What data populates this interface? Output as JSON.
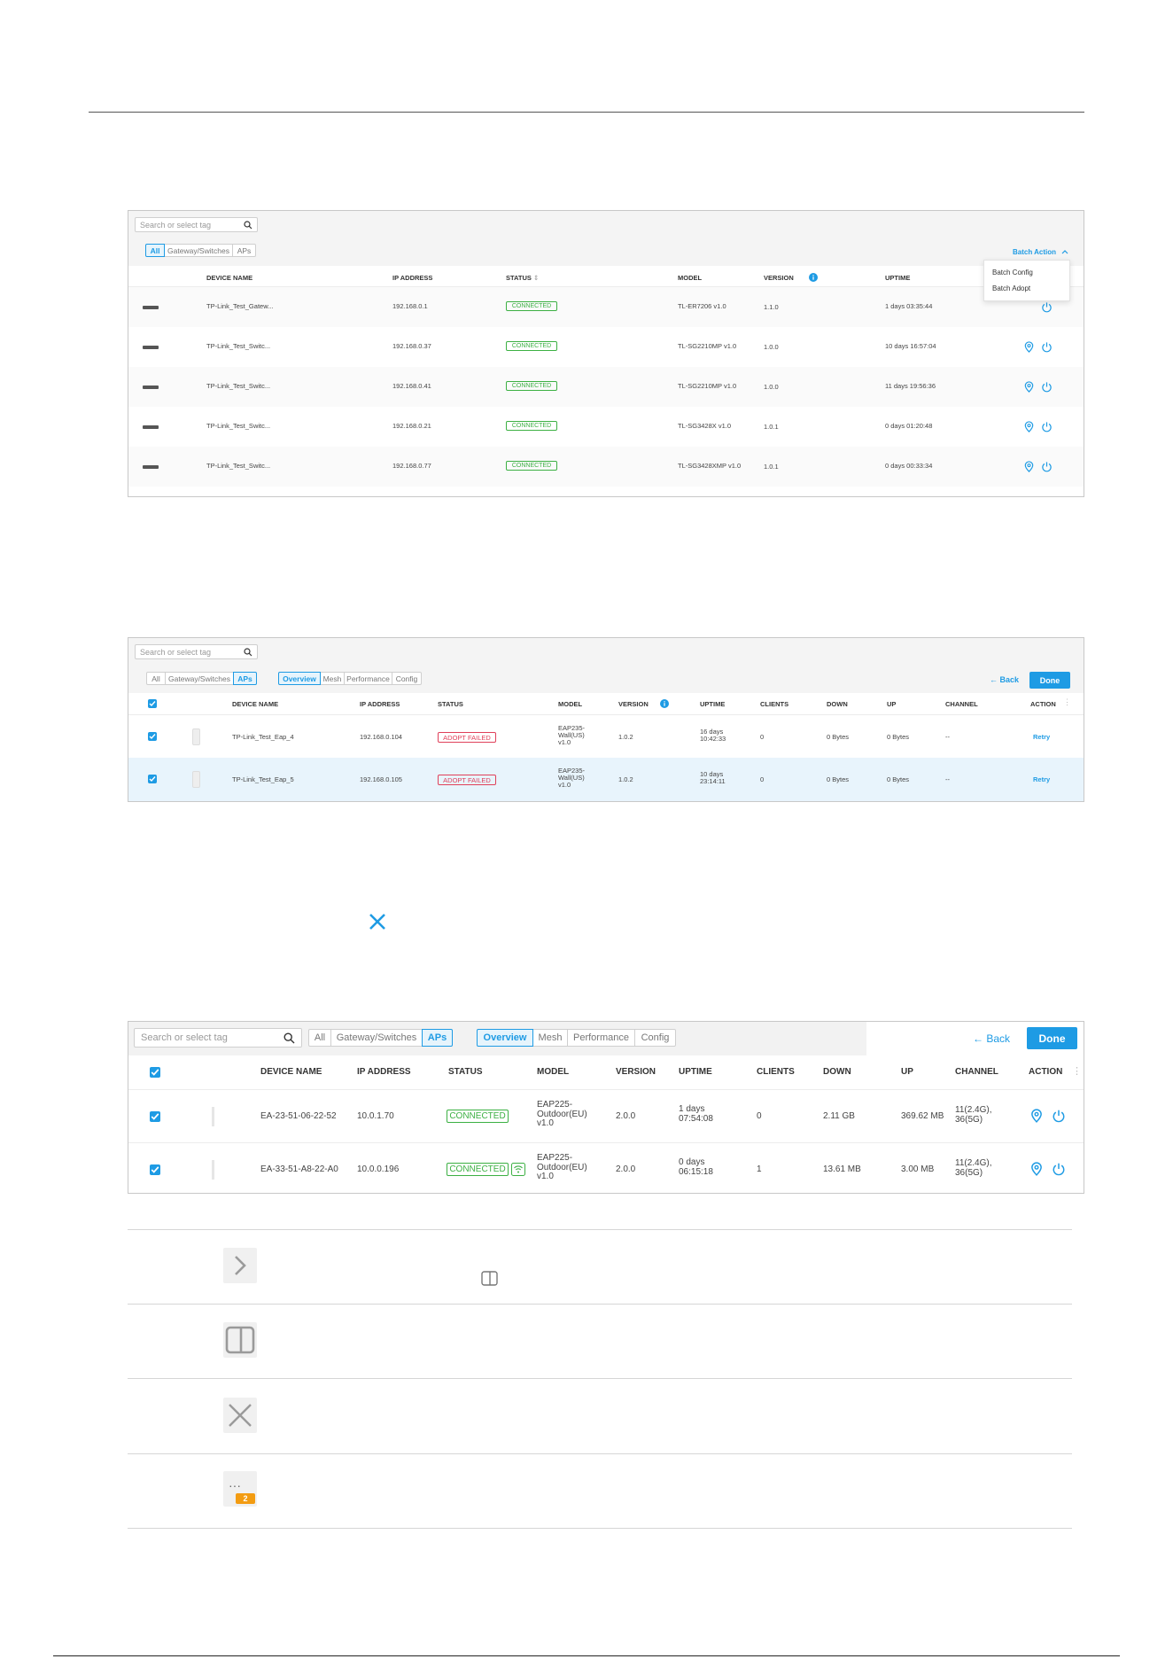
{
  "screenshot1": {
    "search_placeholder": "Search or select tag",
    "filters": [
      "All",
      "Gateway/Switches",
      "APs"
    ],
    "active_filter": "All",
    "batch_action_label": "Batch Action",
    "batch_menu": [
      "Batch Config",
      "Batch Adopt"
    ],
    "headers": {
      "device_name": "DEVICE NAME",
      "ip": "IP ADDRESS",
      "status": "STATUS",
      "model": "MODEL",
      "version": "VERSION",
      "uptime": "UPTIME"
    },
    "rows": [
      {
        "name": "TP-Link_Test_Gatew...",
        "ip": "192.168.0.1",
        "status": "CONNECTED",
        "model": "TL-ER7206 v1.0",
        "version": "1.1.0",
        "uptime": "1 days 03:35:44"
      },
      {
        "name": "TP-Link_Test_Switc...",
        "ip": "192.168.0.37",
        "status": "CONNECTED",
        "model": "TL-SG2210MP v1.0",
        "version": "1.0.0",
        "uptime": "10 days 16:57:04"
      },
      {
        "name": "TP-Link_Test_Switc...",
        "ip": "192.168.0.41",
        "status": "CONNECTED",
        "model": "TL-SG2210MP v1.0",
        "version": "1.0.0",
        "uptime": "11 days 19:56:36"
      },
      {
        "name": "TP-Link_Test_Switc...",
        "ip": "192.168.0.21",
        "status": "CONNECTED",
        "model": "TL-SG3428X v1.0",
        "version": "1.0.1",
        "uptime": "0 days 01:20:48"
      },
      {
        "name": "TP-Link_Test_Switc...",
        "ip": "192.168.0.77",
        "status": "CONNECTED",
        "model": "TL-SG3428XMP v1.0",
        "version": "1.0.1",
        "uptime": "0 days 00:33:34"
      }
    ]
  },
  "screenshot2": {
    "search_placeholder": "Search or select tag",
    "filters": [
      "All",
      "Gateway/Switches",
      "APs"
    ],
    "views": [
      "Overview",
      "Mesh",
      "Performance",
      "Config"
    ],
    "back_label": "Back",
    "done_label": "Done",
    "headers": {
      "device_name": "DEVICE NAME",
      "ip": "IP ADDRESS",
      "status": "STATUS",
      "model": "MODEL",
      "version": "VERSION",
      "uptime": "UPTIME",
      "clients": "CLIENTS",
      "down": "DOWN",
      "up": "UP",
      "channel": "CHANNEL",
      "action": "ACTION"
    },
    "rows": [
      {
        "name": "TP-Link_Test_Eap_4",
        "ip": "192.168.0.104",
        "status": "ADOPT FAILED",
        "model": [
          "EAP235-",
          "Wall(US)",
          "v1.0"
        ],
        "version": "1.0.2",
        "uptime": [
          "16 days",
          "10:42:33"
        ],
        "clients": "0",
        "down": "0 Bytes",
        "up": "0 Bytes",
        "channel": "--",
        "action": "Retry"
      },
      {
        "name": "TP-Link_Test_Eap_5",
        "ip": "192.168.0.105",
        "status": "ADOPT FAILED",
        "model": [
          "EAP235-",
          "Wall(US)",
          "v1.0"
        ],
        "version": "1.0.2",
        "uptime": [
          "10 days",
          "23:14:11"
        ],
        "clients": "0",
        "down": "0 Bytes",
        "up": "0 Bytes",
        "channel": "--",
        "action": "Retry"
      }
    ]
  },
  "screenshot3": {
    "search_placeholder": "Search or select tag",
    "filters": [
      "All",
      "Gateway/Switches",
      "APs"
    ],
    "views": [
      "Overview",
      "Mesh",
      "Performance",
      "Config"
    ],
    "back_label": "Back",
    "done_label": "Done",
    "headers": {
      "device_name": "DEVICE NAME",
      "ip": "IP ADDRESS",
      "status": "STATUS",
      "model": "MODEL",
      "version": "VERSION",
      "uptime": "UPTIME",
      "clients": "CLIENTS",
      "down": "DOWN",
      "up": "UP",
      "channel": "CHANNEL",
      "action": "ACTION"
    },
    "rows": [
      {
        "name": "EA-23-51-06-22-52",
        "ip": "10.0.1.70",
        "status": "CONNECTED",
        "model": [
          "EAP225-",
          "Outdoor(EU)",
          "v1.0"
        ],
        "version": "2.0.0",
        "uptime": [
          "1 days",
          "07:54:08"
        ],
        "clients": "0",
        "down": "2.11 GB",
        "up": "369.62 MB",
        "channel": [
          "11(2.4G),",
          "36(5G)"
        ]
      },
      {
        "name": "EA-33-51-A8-22-A0",
        "ip": "10.0.0.196",
        "status": "CONNECTED",
        "model": [
          "EAP225-",
          "Outdoor(EU)",
          "v1.0"
        ],
        "version": "2.0.0",
        "uptime": [
          "0 days",
          "06:15:18"
        ],
        "clients": "1",
        "down": "13.61 MB",
        "up": "3.00 MB",
        "channel": [
          "11(2.4G),",
          "36(5G)"
        ]
      }
    ]
  },
  "legend_badge_count": "2",
  "colors": {
    "accent": "#1e9be4",
    "connected": "#3cb043",
    "failed": "#e0405a",
    "badge": "#f39c12"
  }
}
